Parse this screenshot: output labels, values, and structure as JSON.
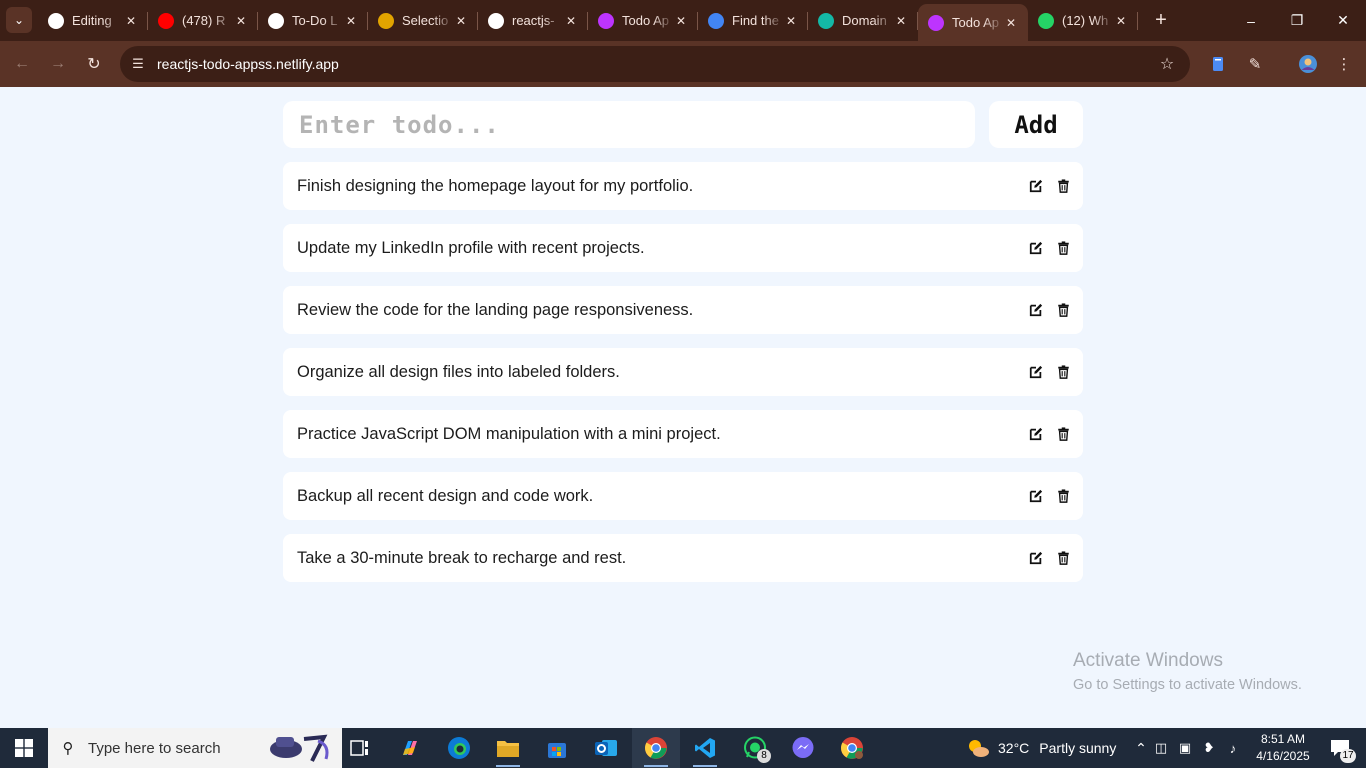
{
  "browser": {
    "tabs": [
      {
        "title": "Editing",
        "icon": "github-icon",
        "color": "#ffffff",
        "active": false
      },
      {
        "title": "(478) R",
        "icon": "youtube-icon",
        "color": "#ff0000",
        "active": false
      },
      {
        "title": "To-Do L",
        "icon": "chatgpt-icon",
        "color": "#ffffff",
        "active": false
      },
      {
        "title": "Selectio",
        "icon": "zoho-icon",
        "color": "#e2a400",
        "active": false
      },
      {
        "title": "reactjs-",
        "icon": "github-icon",
        "color": "#ffffff",
        "active": false
      },
      {
        "title": "Todo Ap",
        "icon": "vite-icon",
        "color": "#bd34fe",
        "active": false
      },
      {
        "title": "Find the",
        "icon": "flag-icon",
        "color": "#4285f4",
        "active": false
      },
      {
        "title": "Domain",
        "icon": "netlify-icon",
        "color": "#14b8a6",
        "active": false
      },
      {
        "title": "Todo Ap",
        "icon": "vite-icon",
        "color": "#bd34fe",
        "active": true
      },
      {
        "title": "(12) Wh",
        "icon": "whatsapp-icon",
        "color": "#25d366",
        "active": false
      }
    ],
    "url": "reactjs-todo-appss.netlify.app",
    "theme": {
      "frame": "#3c1f16",
      "toolbar": "#5a3326"
    }
  },
  "app": {
    "input_placeholder": "Enter todo...",
    "input_value": "",
    "add_label": "Add",
    "todos": [
      "Finish designing the homepage layout for my portfolio.",
      "Update my LinkedIn profile with recent projects.",
      "Review the code for the landing page responsiveness.",
      "Organize all design files into labeled folders.",
      "Practice JavaScript DOM manipulation with a mini project.",
      "Backup all recent design and code work.",
      "Take a 30-minute break to recharge and rest."
    ],
    "background": "#f0f6fe"
  },
  "watermark": {
    "line1": "Activate Windows",
    "line2": "Go to Settings to activate Windows."
  },
  "taskbar": {
    "search_placeholder": "Type here to search",
    "weather": {
      "temp": "32°C",
      "desc": "Partly sunny"
    },
    "time": "8:51 AM",
    "date": "4/16/2025",
    "whatsapp_badge": "8",
    "notification_count": "17"
  }
}
